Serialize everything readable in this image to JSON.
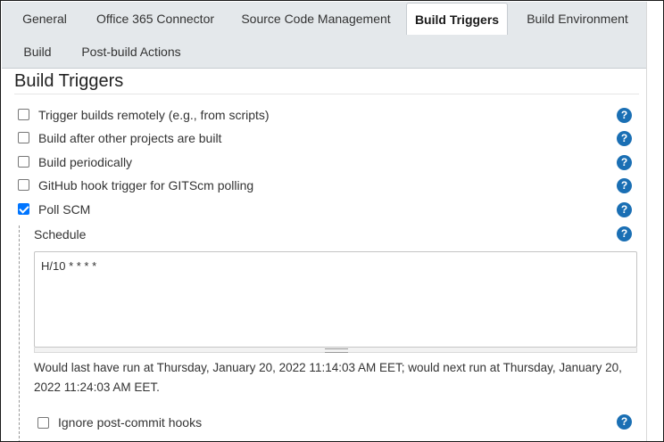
{
  "tabs": [
    {
      "label": "General",
      "active": false
    },
    {
      "label": "Office 365 Connector",
      "active": false
    },
    {
      "label": "Source Code Management",
      "active": false
    },
    {
      "label": "Build Triggers",
      "active": true
    },
    {
      "label": "Build Environment",
      "active": false
    },
    {
      "label": "Build",
      "active": false
    },
    {
      "label": "Post-build Actions",
      "active": false
    }
  ],
  "section": {
    "title": "Build Triggers"
  },
  "triggers": [
    {
      "label": "Trigger builds remotely (e.g., from scripts)",
      "checked": false
    },
    {
      "label": "Build after other projects are built",
      "checked": false
    },
    {
      "label": "Build periodically",
      "checked": false
    },
    {
      "label": "GitHub hook trigger for GITScm polling",
      "checked": false
    },
    {
      "label": "Poll SCM",
      "checked": true
    }
  ],
  "poll_scm": {
    "schedule_label": "Schedule",
    "schedule_value": "H/10 * * * *",
    "run_info": "Would last have run at Thursday, January 20, 2022 11:14:03 AM EET; would next run at Thursday, January 20, 2022 11:24:03 AM EET.",
    "ignore_hooks_label": "Ignore post-commit hooks",
    "ignore_hooks_checked": false
  },
  "help_glyph": "?",
  "colors": {
    "tab_bar": "#e4e8eb",
    "help_icon": "#1a6fb4",
    "checkbox_checked": "#0075ff"
  }
}
